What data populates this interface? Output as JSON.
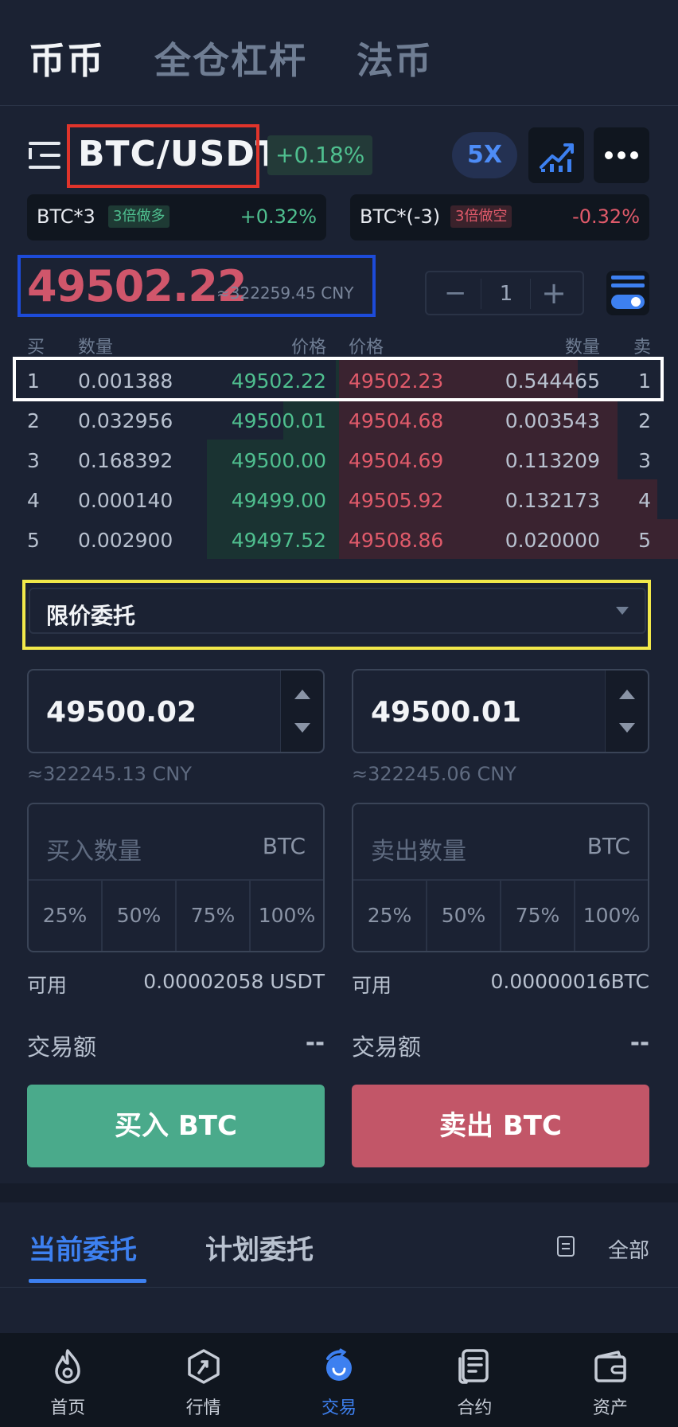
{
  "top_tabs": [
    "币币",
    "全仓杠杆",
    "法币"
  ],
  "pair": {
    "name": "BTC/USDT",
    "change": "+0.18%",
    "leverage": "5X"
  },
  "lev_cards": [
    {
      "name": "BTC*3",
      "tag": "3倍做多",
      "pct": "+0.32%"
    },
    {
      "name": "BTC*(-3)",
      "tag": "3倍做空",
      "pct": "-0.32%"
    }
  ],
  "price": {
    "last": "49502.22",
    "cny": "≈322259.45 CNY"
  },
  "stepper": {
    "value": "1"
  },
  "orderbook": {
    "headers": {
      "buy": "买",
      "qty_left": "数量",
      "price_left": "价格",
      "price_right": "价格",
      "qty_right": "数量",
      "sell": "卖"
    },
    "rows": [
      {
        "idx": "1",
        "bid_qty": "0.001388",
        "bid_price": "49502.22",
        "ask_price": "49502.23",
        "ask_qty": "0.544465",
        "ask_idx": "1"
      },
      {
        "idx": "2",
        "bid_qty": "0.032956",
        "bid_price": "49500.01",
        "ask_price": "49504.68",
        "ask_qty": "0.003543",
        "ask_idx": "2"
      },
      {
        "idx": "3",
        "bid_qty": "0.168392",
        "bid_price": "49500.00",
        "ask_price": "49504.69",
        "ask_qty": "0.113209",
        "ask_idx": "3"
      },
      {
        "idx": "4",
        "bid_qty": "0.000140",
        "bid_price": "49499.00",
        "ask_price": "49505.92",
        "ask_qty": "0.132173",
        "ask_idx": "4"
      },
      {
        "idx": "5",
        "bid_qty": "0.002900",
        "bid_price": "49497.52",
        "ask_price": "49508.86",
        "ask_qty": "0.020000",
        "ask_idx": "5"
      }
    ]
  },
  "order_type": "限价委托",
  "buy_form": {
    "price": "49500.02",
    "cny": "≈322245.13 CNY",
    "qty_placeholder": "买入数量",
    "unit": "BTC",
    "pcts": [
      "25%",
      "50%",
      "75%",
      "100%"
    ],
    "avail_label": "可用",
    "avail_value": "0.00002058 USDT",
    "amount_label": "交易额",
    "amount_value": "--",
    "button": "买入 BTC"
  },
  "sell_form": {
    "price": "49500.01",
    "cny": "≈322245.06 CNY",
    "qty_placeholder": "卖出数量",
    "unit": "BTC",
    "pcts": [
      "25%",
      "50%",
      "75%",
      "100%"
    ],
    "avail_label": "可用",
    "avail_value": "0.00000016BTC",
    "amount_label": "交易额",
    "amount_value": "--",
    "button": "卖出 BTC"
  },
  "orders_tabs": {
    "current": "当前委托",
    "plan": "计划委托",
    "all": "全部"
  },
  "bottom_nav": [
    {
      "label": "首页",
      "icon": "flame-icon"
    },
    {
      "label": "行情",
      "icon": "market-icon"
    },
    {
      "label": "交易",
      "icon": "trade-icon"
    },
    {
      "label": "合约",
      "icon": "contract-icon"
    },
    {
      "label": "资产",
      "icon": "wallet-icon"
    }
  ],
  "colors": {
    "background": "#1b2233",
    "green": "#4fbf8f",
    "red": "#e05a6a",
    "accent": "#3d80f0"
  }
}
